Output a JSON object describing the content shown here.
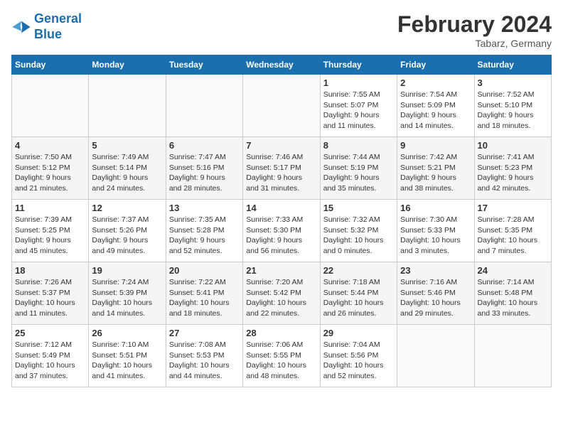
{
  "header": {
    "logo_line1": "General",
    "logo_line2": "Blue",
    "month": "February 2024",
    "location": "Tabarz, Germany"
  },
  "days_of_week": [
    "Sunday",
    "Monday",
    "Tuesday",
    "Wednesday",
    "Thursday",
    "Friday",
    "Saturday"
  ],
  "weeks": [
    [
      {
        "day": "",
        "info": ""
      },
      {
        "day": "",
        "info": ""
      },
      {
        "day": "",
        "info": ""
      },
      {
        "day": "",
        "info": ""
      },
      {
        "day": "1",
        "info": "Sunrise: 7:55 AM\nSunset: 5:07 PM\nDaylight: 9 hours\nand 11 minutes."
      },
      {
        "day": "2",
        "info": "Sunrise: 7:54 AM\nSunset: 5:09 PM\nDaylight: 9 hours\nand 14 minutes."
      },
      {
        "day": "3",
        "info": "Sunrise: 7:52 AM\nSunset: 5:10 PM\nDaylight: 9 hours\nand 18 minutes."
      }
    ],
    [
      {
        "day": "4",
        "info": "Sunrise: 7:50 AM\nSunset: 5:12 PM\nDaylight: 9 hours\nand 21 minutes."
      },
      {
        "day": "5",
        "info": "Sunrise: 7:49 AM\nSunset: 5:14 PM\nDaylight: 9 hours\nand 24 minutes."
      },
      {
        "day": "6",
        "info": "Sunrise: 7:47 AM\nSunset: 5:16 PM\nDaylight: 9 hours\nand 28 minutes."
      },
      {
        "day": "7",
        "info": "Sunrise: 7:46 AM\nSunset: 5:17 PM\nDaylight: 9 hours\nand 31 minutes."
      },
      {
        "day": "8",
        "info": "Sunrise: 7:44 AM\nSunset: 5:19 PM\nDaylight: 9 hours\nand 35 minutes."
      },
      {
        "day": "9",
        "info": "Sunrise: 7:42 AM\nSunset: 5:21 PM\nDaylight: 9 hours\nand 38 minutes."
      },
      {
        "day": "10",
        "info": "Sunrise: 7:41 AM\nSunset: 5:23 PM\nDaylight: 9 hours\nand 42 minutes."
      }
    ],
    [
      {
        "day": "11",
        "info": "Sunrise: 7:39 AM\nSunset: 5:25 PM\nDaylight: 9 hours\nand 45 minutes."
      },
      {
        "day": "12",
        "info": "Sunrise: 7:37 AM\nSunset: 5:26 PM\nDaylight: 9 hours\nand 49 minutes."
      },
      {
        "day": "13",
        "info": "Sunrise: 7:35 AM\nSunset: 5:28 PM\nDaylight: 9 hours\nand 52 minutes."
      },
      {
        "day": "14",
        "info": "Sunrise: 7:33 AM\nSunset: 5:30 PM\nDaylight: 9 hours\nand 56 minutes."
      },
      {
        "day": "15",
        "info": "Sunrise: 7:32 AM\nSunset: 5:32 PM\nDaylight: 10 hours\nand 0 minutes."
      },
      {
        "day": "16",
        "info": "Sunrise: 7:30 AM\nSunset: 5:33 PM\nDaylight: 10 hours\nand 3 minutes."
      },
      {
        "day": "17",
        "info": "Sunrise: 7:28 AM\nSunset: 5:35 PM\nDaylight: 10 hours\nand 7 minutes."
      }
    ],
    [
      {
        "day": "18",
        "info": "Sunrise: 7:26 AM\nSunset: 5:37 PM\nDaylight: 10 hours\nand 11 minutes."
      },
      {
        "day": "19",
        "info": "Sunrise: 7:24 AM\nSunset: 5:39 PM\nDaylight: 10 hours\nand 14 minutes."
      },
      {
        "day": "20",
        "info": "Sunrise: 7:22 AM\nSunset: 5:41 PM\nDaylight: 10 hours\nand 18 minutes."
      },
      {
        "day": "21",
        "info": "Sunrise: 7:20 AM\nSunset: 5:42 PM\nDaylight: 10 hours\nand 22 minutes."
      },
      {
        "day": "22",
        "info": "Sunrise: 7:18 AM\nSunset: 5:44 PM\nDaylight: 10 hours\nand 26 minutes."
      },
      {
        "day": "23",
        "info": "Sunrise: 7:16 AM\nSunset: 5:46 PM\nDaylight: 10 hours\nand 29 minutes."
      },
      {
        "day": "24",
        "info": "Sunrise: 7:14 AM\nSunset: 5:48 PM\nDaylight: 10 hours\nand 33 minutes."
      }
    ],
    [
      {
        "day": "25",
        "info": "Sunrise: 7:12 AM\nSunset: 5:49 PM\nDaylight: 10 hours\nand 37 minutes."
      },
      {
        "day": "26",
        "info": "Sunrise: 7:10 AM\nSunset: 5:51 PM\nDaylight: 10 hours\nand 41 minutes."
      },
      {
        "day": "27",
        "info": "Sunrise: 7:08 AM\nSunset: 5:53 PM\nDaylight: 10 hours\nand 44 minutes."
      },
      {
        "day": "28",
        "info": "Sunrise: 7:06 AM\nSunset: 5:55 PM\nDaylight: 10 hours\nand 48 minutes."
      },
      {
        "day": "29",
        "info": "Sunrise: 7:04 AM\nSunset: 5:56 PM\nDaylight: 10 hours\nand 52 minutes."
      },
      {
        "day": "",
        "info": ""
      },
      {
        "day": "",
        "info": ""
      }
    ]
  ]
}
